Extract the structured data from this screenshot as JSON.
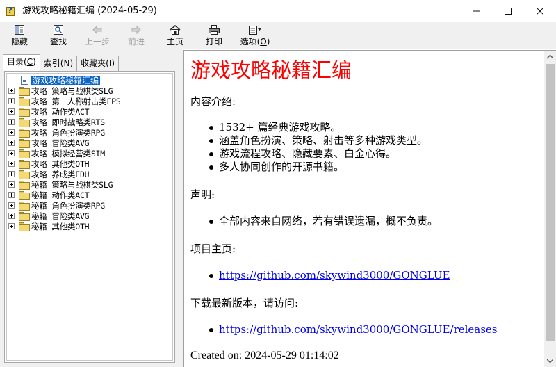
{
  "window": {
    "title": "游戏攻略秘籍汇编 (2024-05-29)"
  },
  "toolbar": {
    "hide": "隐藏",
    "find": "查找",
    "back": "上一步",
    "forward": "前进",
    "home": "主页",
    "print": "打印",
    "options_prefix": "选项(",
    "options_key": "O",
    "options_suffix": ")"
  },
  "tabs": [
    {
      "prefix": "目录(",
      "key": "C",
      "suffix": ")"
    },
    {
      "prefix": "索引(",
      "key": "N",
      "suffix": ")"
    },
    {
      "prefix": "收藏夹(",
      "key": "I",
      "suffix": ")"
    }
  ],
  "tree": {
    "root": "游戏攻略秘籍汇编",
    "items": [
      "攻略  策略与战棋类SLG",
      "攻略  第一人称射击类FPS",
      "攻略  动作类ACT",
      "攻略  即时战略类RTS",
      "攻略  角色扮演类RPG",
      "攻略  冒险类AVG",
      "攻略  模拟经营类SIM",
      "攻略  其他类OTH",
      "攻略  养成类EDU",
      "秘籍  策略与战棋类SLG",
      "秘籍  动作类ACT",
      "秘籍  角色扮演类RPG",
      "秘籍  冒险类AVG",
      "秘籍  其他类OTH"
    ]
  },
  "content": {
    "heading": "游戏攻略秘籍汇编",
    "intro_label": "内容介绍:",
    "intro_items": [
      "1532+ 篇经典游戏攻略。",
      "涵盖角色扮演、策略、射击等多种游戏类型。",
      "游戏流程攻略、隐藏要素、白金心得。",
      "多人协同创作的开源书籍。"
    ],
    "notice_label": "声明:",
    "notice_items": [
      "全部内容来自网络，若有错误遗漏，概不负责。"
    ],
    "homepage_label": "项目主页:",
    "homepage_link": "https://github.com/skywind3000/GONGLUE",
    "download_label": "下载最新版本，请访问:",
    "download_link": "https://github.com/skywind3000/GONGLUE/releases",
    "created": "Created on: 2024-05-29 01:14:02"
  }
}
